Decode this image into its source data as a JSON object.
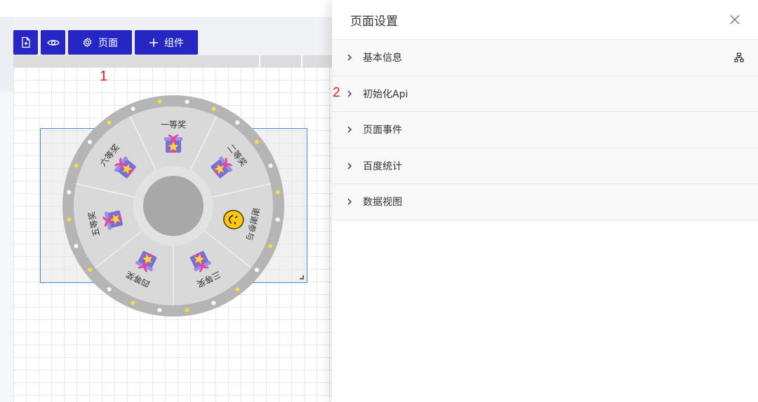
{
  "toolbar": {
    "buttons": [
      {
        "icon": "file-add-icon"
      },
      {
        "icon": "eye-icon"
      },
      {
        "icon": "gear-icon",
        "label": "页面"
      },
      {
        "icon": "plus-icon",
        "label": "组件"
      }
    ]
  },
  "annotations": {
    "marker_1": "1",
    "marker_2": "2"
  },
  "wheel": {
    "prizes": [
      "一等奖",
      "二等奖",
      "谢谢参与",
      "三等奖",
      "四等奖",
      "五等奖",
      "六等奖"
    ],
    "prize_icons": [
      "gift-icon",
      "gift-icon",
      "smiley-icon",
      "gift-icon",
      "gift-icon",
      "gift-icon",
      "gift-icon"
    ],
    "colors": {
      "rim": "#b5b5b5",
      "face": "#d9d9d9",
      "hub": "#a8a8a8",
      "bulb_white": "#ffffff",
      "bulb_yellow": "#f5dc3c"
    }
  },
  "panel": {
    "title": "页面设置",
    "close_icon": "close-icon",
    "sections": [
      {
        "label": "基本信息",
        "extra_icon": "sitemap-icon"
      },
      {
        "label": "初始化Api"
      },
      {
        "label": "页面事件"
      },
      {
        "label": "百度统计"
      },
      {
        "label": "数据视图"
      }
    ]
  },
  "colors": {
    "accent": "#2626c4",
    "annotation": "#f01818",
    "selection": "#3a8ee6"
  }
}
